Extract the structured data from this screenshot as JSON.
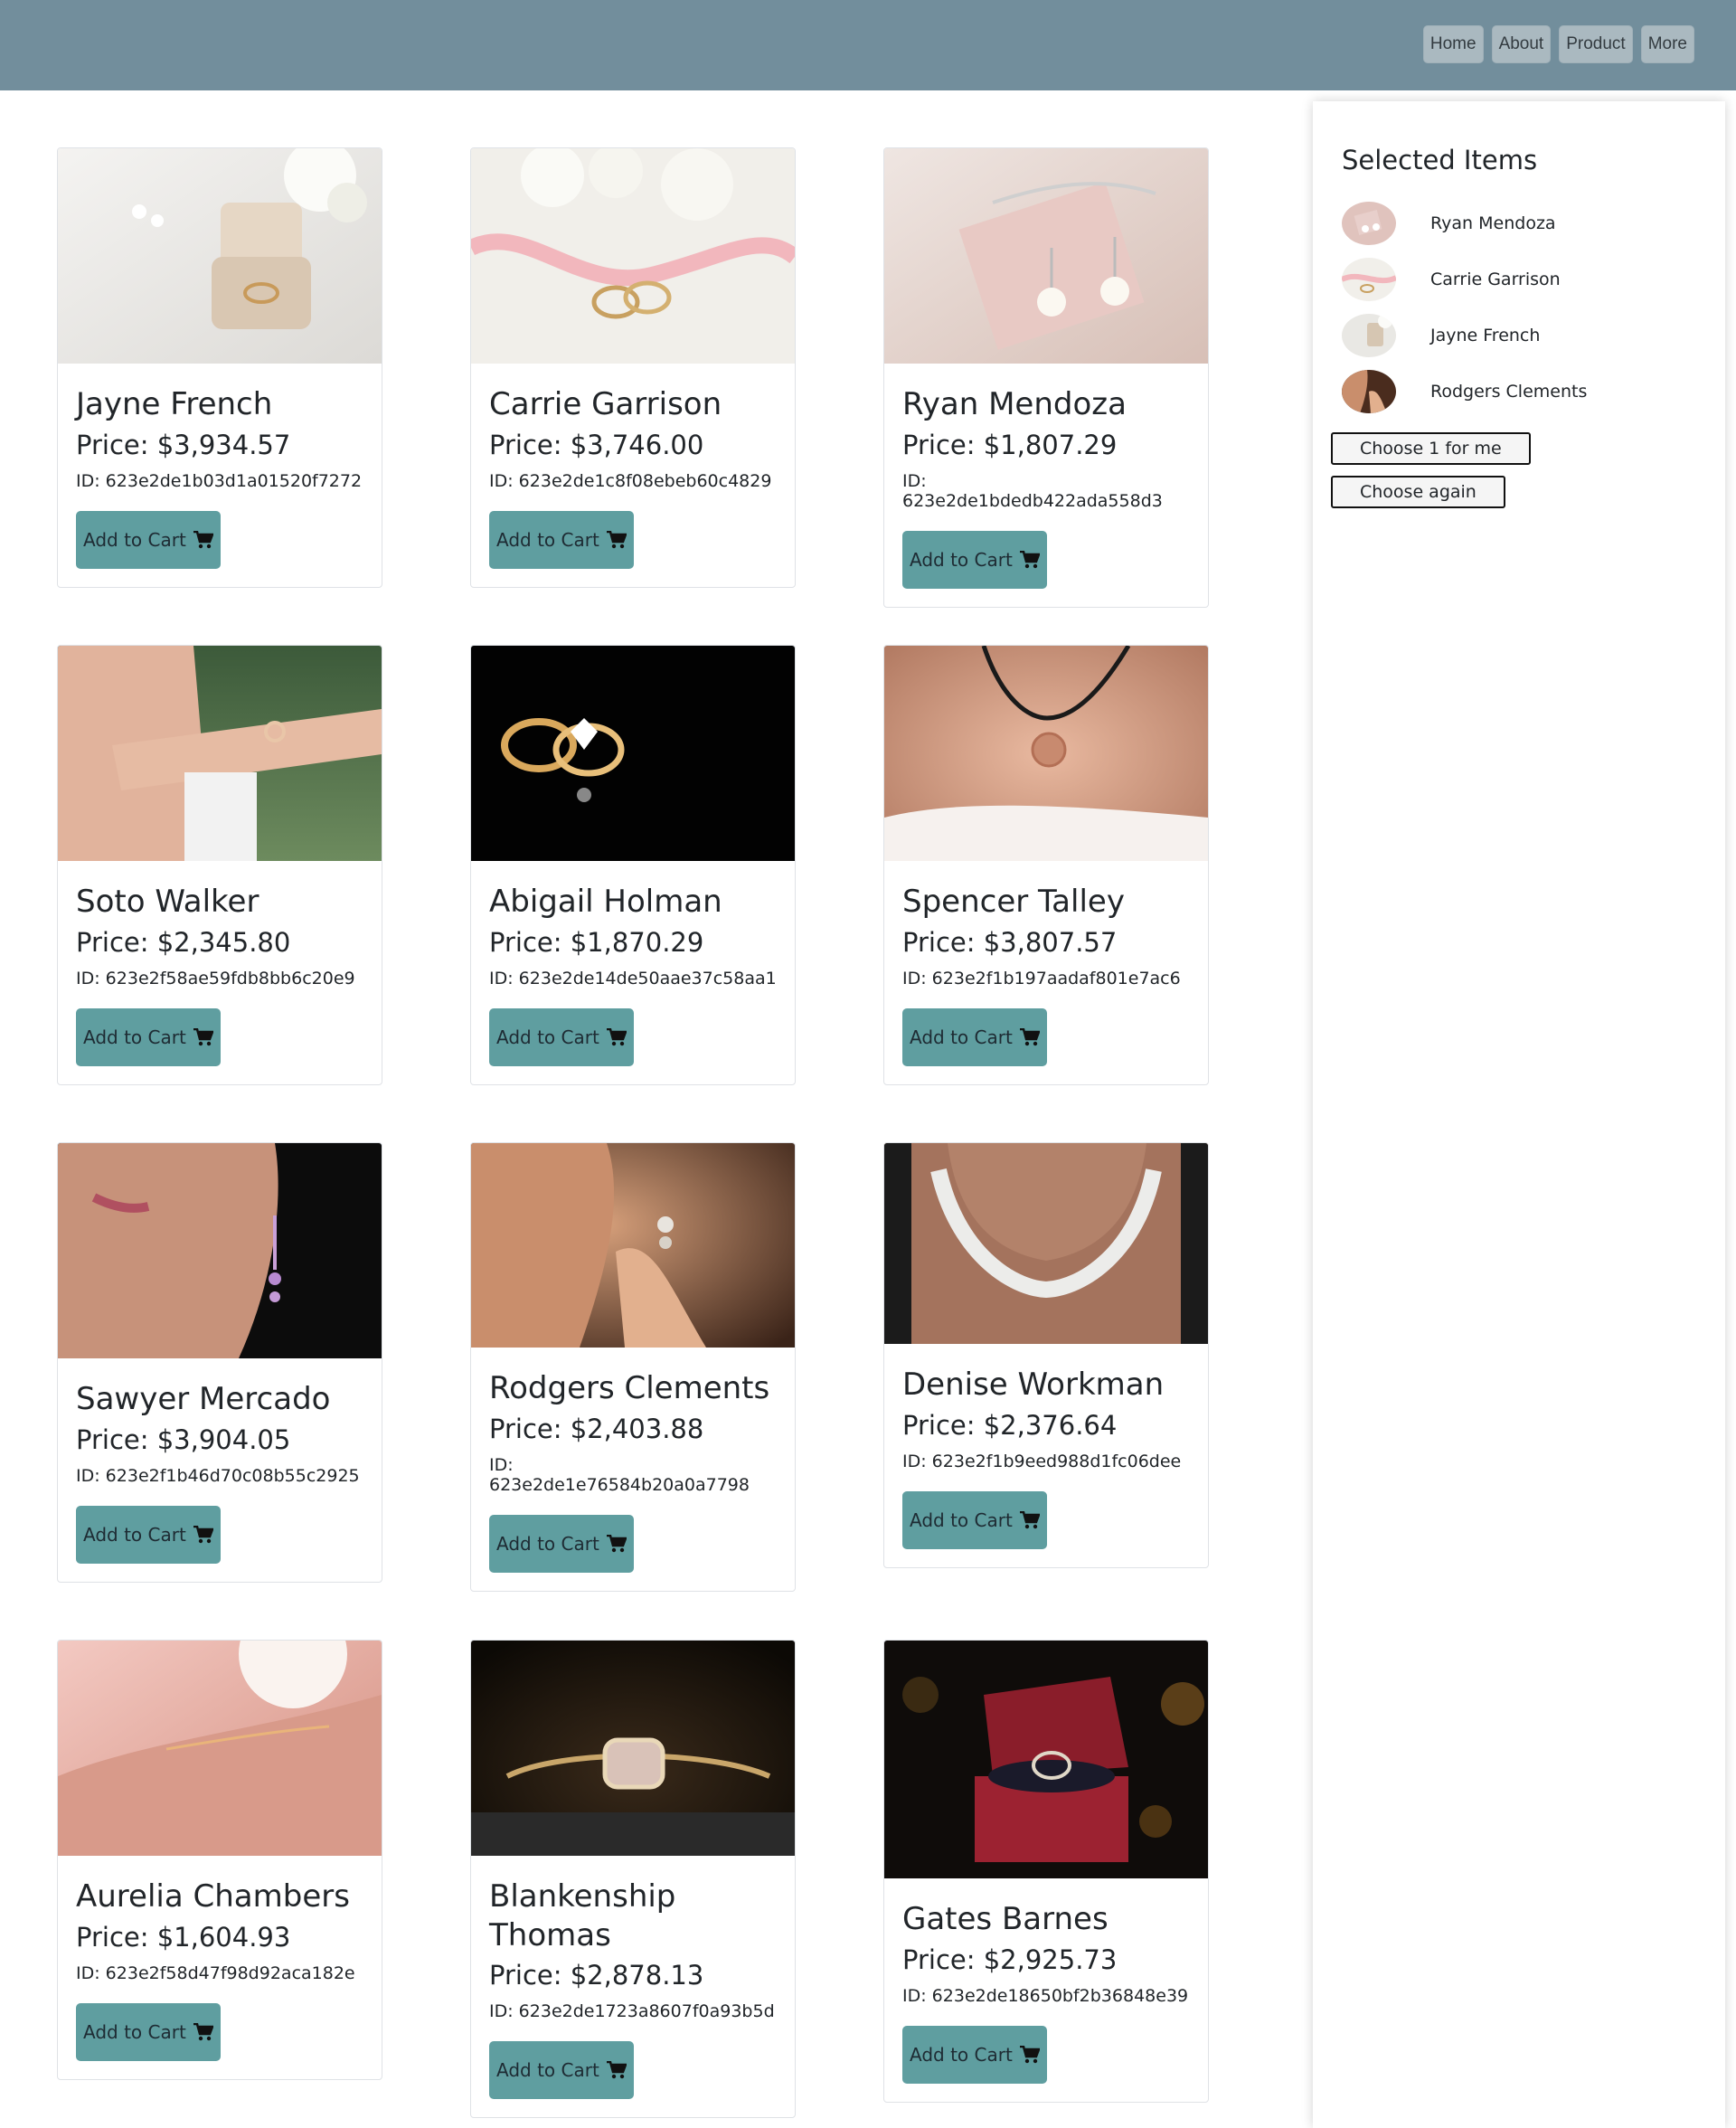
{
  "nav": {
    "home": "Home",
    "about": "About",
    "product": "Product",
    "more": "More"
  },
  "products": [
    {
      "name": "Jayne French",
      "price": "Price: $3,934.57",
      "id": "ID: 623e2de1b03d1a01520f7272",
      "cart": "Add to Cart"
    },
    {
      "name": "Carrie Garrison",
      "price": "Price: $3,746.00",
      "id": "ID: 623e2de1c8f08ebeb60c4829",
      "cart": "Add to Cart"
    },
    {
      "name": "Ryan Mendoza",
      "price": "Price: $1,807.29",
      "id": "ID: 623e2de1bdedb422ada558d3",
      "cart": "Add to Cart"
    },
    {
      "name": "Soto Walker",
      "price": "Price: $2,345.80",
      "id": "ID: 623e2f58ae59fdb8bb6c20e9",
      "cart": "Add to Cart"
    },
    {
      "name": "Abigail Holman",
      "price": "Price: $1,870.29",
      "id": "ID: 623e2de14de50aae37c58aa1",
      "cart": "Add to Cart"
    },
    {
      "name": "Spencer Talley",
      "price": "Price: $3,807.57",
      "id": "ID: 623e2f1b197aadaf801e7ac6",
      "cart": "Add to Cart"
    },
    {
      "name": "Sawyer Mercado",
      "price": "Price: $3,904.05",
      "id": "ID: 623e2f1b46d70c08b55c2925",
      "cart": "Add to Cart"
    },
    {
      "name": "Rodgers Clements",
      "price": "Price: $2,403.88",
      "id": "ID: 623e2de1e76584b20a0a7798",
      "cart": "Add to Cart"
    },
    {
      "name": "Denise Workman",
      "price": "Price: $2,376.64",
      "id": "ID: 623e2f1b9eed988d1fc06dee",
      "cart": "Add to Cart"
    },
    {
      "name": "Aurelia Chambers",
      "price": "Price: $1,604.93",
      "id": "ID: 623e2f58d47f98d92aca182e",
      "cart": "Add to Cart"
    },
    {
      "name": "Blankenship Thomas",
      "price": "Price: $2,878.13",
      "id": "ID: 623e2de1723a8607f0a93b5d",
      "cart": "Add to Cart"
    },
    {
      "name": "Gates Barnes",
      "price": "Price: $2,925.73",
      "id": "ID: 623e2de18650bf2b36848e39",
      "cart": "Add to Cart"
    }
  ],
  "sidebar": {
    "title": "Selected Items",
    "items": [
      {
        "name": "Ryan Mendoza"
      },
      {
        "name": "Carrie Garrison"
      },
      {
        "name": "Jayne French"
      },
      {
        "name": "Rodgers Clements"
      }
    ],
    "choose_one": "Choose 1 for me",
    "choose_again": "Choose again"
  },
  "colors": {
    "navbar": "#728e9c",
    "cart_button": "#5f9ea0",
    "nav_button": "#aab9c0"
  }
}
